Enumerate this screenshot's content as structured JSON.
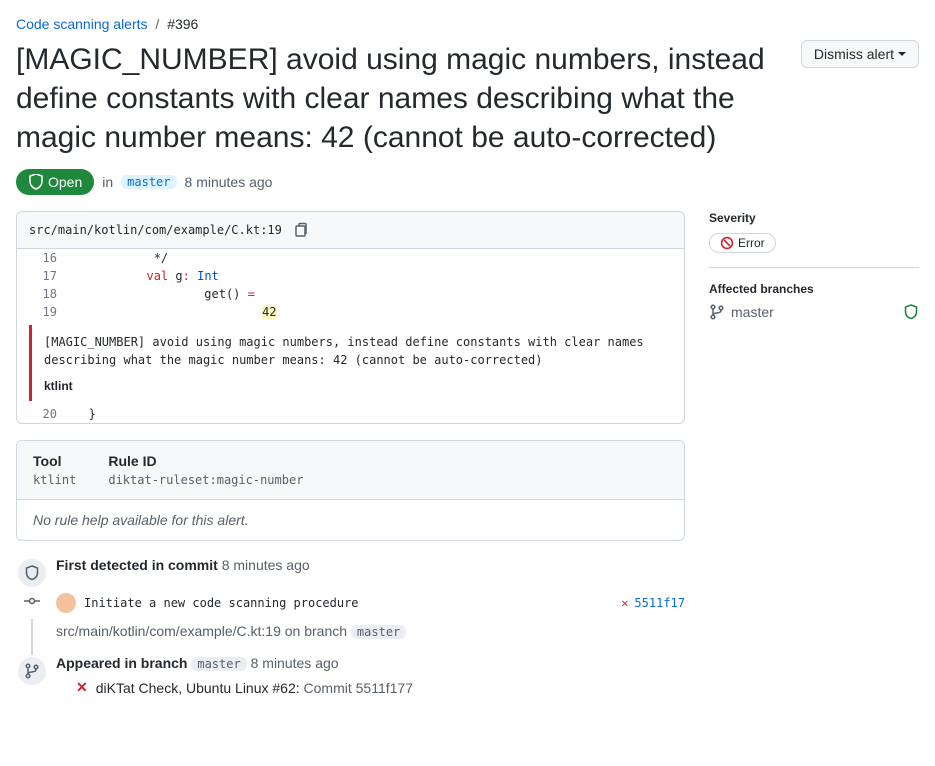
{
  "breadcrumb": {
    "parent": "Code scanning alerts",
    "current": "#396"
  },
  "title": "[MAGIC_NUMBER] avoid using magic numbers, instead define constants with clear names describing what the magic number means: 42 (cannot be auto-corrected)",
  "dismiss_label": "Dismiss alert",
  "status": {
    "state": "Open",
    "in_text": "in",
    "branch": "master",
    "time": "8 minutes ago"
  },
  "file": {
    "path": "src/main/kotlin/com/example/C.kt",
    "line": "19"
  },
  "code": {
    "lines": [
      {
        "no": "16",
        "content_html": "            */"
      },
      {
        "no": "17",
        "content_html": "           <span class=\"kw\">val</span> g<span class=\"op\">:</span> <span class=\"type\">Int</span>"
      },
      {
        "no": "18",
        "content_html": "                   get() <span class=\"op\">=</span>"
      },
      {
        "no": "19",
        "content_html": "                           <span class=\"num-hl\">42</span>"
      }
    ],
    "after": {
      "no": "20",
      "content_html": "   }"
    },
    "message": "[MAGIC_NUMBER] avoid using magic numbers, instead define constants with clear names describing what the magic number means: 42 (cannot be auto-corrected)",
    "tool": "ktlint"
  },
  "meta": {
    "tool_label": "Tool",
    "tool_value": "ktlint",
    "rule_label": "Rule ID",
    "rule_value": "diktat-ruleset:magic-number",
    "no_help": "No rule help available for this alert."
  },
  "sidebar": {
    "severity_title": "Severity",
    "severity_value": "Error",
    "affected_title": "Affected branches",
    "affected_branch": "master"
  },
  "timeline": {
    "first_detected": {
      "title": "First detected in commit",
      "time": "8 minutes ago",
      "commit_msg": "Initiate a new code scanning procedure",
      "commit_sha": "5511f17",
      "file_path": "src/main/kotlin/com/example/C.kt:19",
      "on_branch_text": "on branch",
      "branch": "master"
    },
    "appeared": {
      "title": "Appeared in branch",
      "branch": "master",
      "time": "8 minutes ago",
      "check_name": "diKTat Check, Ubuntu Linux #62:",
      "check_commit": "Commit 5511f177"
    }
  }
}
